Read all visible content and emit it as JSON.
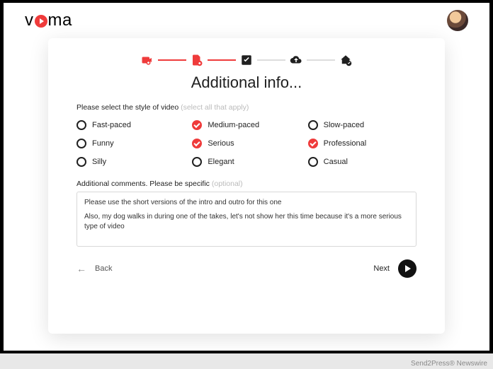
{
  "brand": {
    "pre": "v",
    "post": "ma"
  },
  "stepper": {
    "steps": [
      {
        "name": "record",
        "active": true
      },
      {
        "name": "file",
        "active": true
      },
      {
        "name": "check",
        "active": false
      },
      {
        "name": "cloud",
        "active": false
      },
      {
        "name": "deliver",
        "active": false
      }
    ]
  },
  "title": "Additional info...",
  "style_prompt": {
    "main": "Please select the style of video",
    "hint": "(select all that apply)"
  },
  "options": [
    {
      "label": "Fast-paced",
      "checked": false
    },
    {
      "label": "Medium-paced",
      "checked": true
    },
    {
      "label": "Slow-paced",
      "checked": false
    },
    {
      "label": "Funny",
      "checked": false
    },
    {
      "label": "Serious",
      "checked": true
    },
    {
      "label": "Professional",
      "checked": true
    },
    {
      "label": "Silly",
      "checked": false
    },
    {
      "label": "Elegant",
      "checked": false
    },
    {
      "label": "Casual",
      "checked": false
    }
  ],
  "comments": {
    "label_main": "Additional comments. Please be specific",
    "label_hint": "(optional)",
    "line1": "Please use the short versions of the intro and outro for this one",
    "line2": "Also, my dog walks in during one of the takes, let's not show her this time because it's a more serious type of video"
  },
  "nav": {
    "back": "Back",
    "next": "Next"
  },
  "credit": "Send2Press® Newswire"
}
